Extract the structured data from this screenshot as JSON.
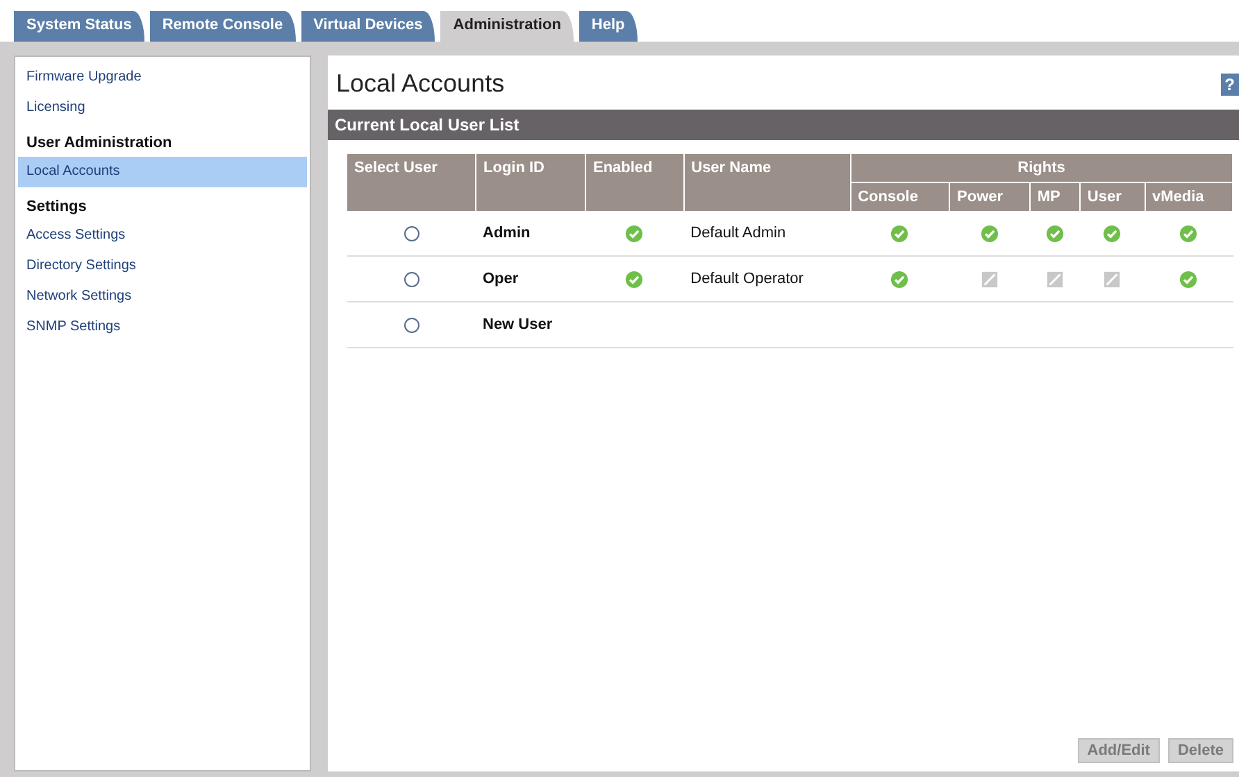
{
  "tabs": [
    {
      "label": "System Status",
      "selected": false
    },
    {
      "label": "Remote Console",
      "selected": false
    },
    {
      "label": "Virtual Devices",
      "selected": false
    },
    {
      "label": "Administration",
      "selected": true
    },
    {
      "label": "Help",
      "selected": false
    }
  ],
  "sidebar": {
    "items": [
      {
        "kind": "link",
        "label": "Firmware Upgrade",
        "selected": false
      },
      {
        "kind": "link",
        "label": "Licensing",
        "selected": false
      },
      {
        "kind": "heading",
        "label": "User Administration"
      },
      {
        "kind": "link",
        "label": "Local Accounts",
        "selected": true
      },
      {
        "kind": "heading",
        "label": "Settings"
      },
      {
        "kind": "link",
        "label": "Access Settings",
        "selected": false
      },
      {
        "kind": "link",
        "label": "Directory Settings",
        "selected": false
      },
      {
        "kind": "link",
        "label": "Network Settings",
        "selected": false
      },
      {
        "kind": "link",
        "label": "SNMP Settings",
        "selected": false
      }
    ]
  },
  "page": {
    "title": "Local Accounts",
    "help": "?"
  },
  "section": {
    "title": "Current Local User List"
  },
  "table": {
    "columns": [
      "Select User",
      "Login ID",
      "Enabled",
      "User Name"
    ],
    "group": "Rights",
    "rights_columns": [
      "Console",
      "Power",
      "MP",
      "User",
      "vMedia"
    ],
    "rows": [
      {
        "selected": false,
        "login": "Admin",
        "enabled": true,
        "name": "Default Admin",
        "rights": [
          true,
          true,
          true,
          true,
          true
        ]
      },
      {
        "selected": false,
        "login": "Oper",
        "enabled": true,
        "name": "Default Operator",
        "rights": [
          true,
          false,
          false,
          false,
          true
        ]
      },
      {
        "selected": false,
        "login": "New User"
      }
    ]
  },
  "buttons": [
    {
      "label": "Add/Edit",
      "disabled": true
    },
    {
      "label": "Delete",
      "disabled": true
    }
  ]
}
